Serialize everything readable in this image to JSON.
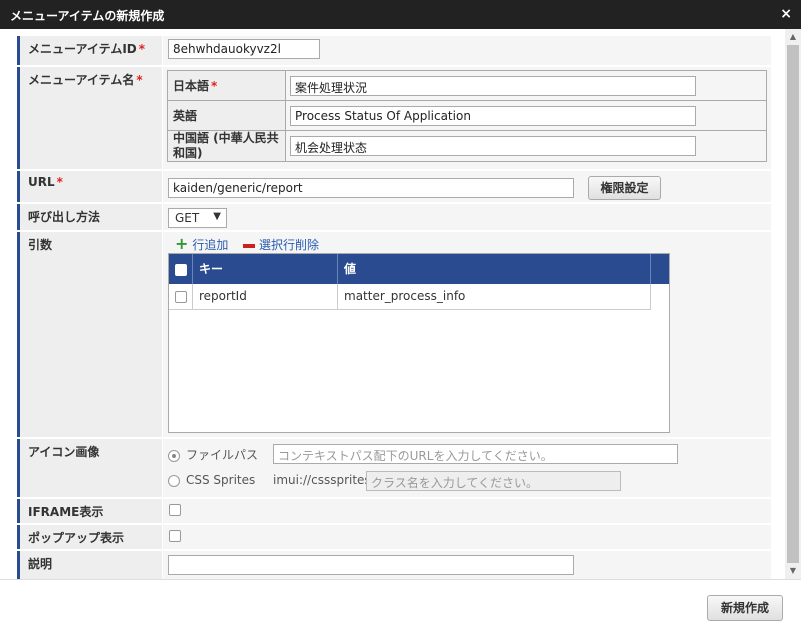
{
  "dialog": {
    "title": "メニューアイテムの新規作成",
    "close_label": "×"
  },
  "fields": {
    "id": {
      "label": "メニューアイテムID",
      "required_mark": "*",
      "value": "8ehwhdauokyvz2l"
    },
    "name": {
      "label": "メニューアイテム名",
      "required_mark": "*",
      "languages": [
        {
          "lang": "日本語",
          "required_mark": "*",
          "value": "案件処理状況"
        },
        {
          "lang": "英語",
          "value": "Process Status Of Application"
        },
        {
          "lang": "中国語 (中華人民共和国)",
          "value": "机会处理状态"
        }
      ]
    },
    "url": {
      "label": "URL",
      "required_mark": "*",
      "value": "kaiden/generic/report",
      "button_label": "権限設定"
    },
    "method": {
      "label": "呼び出し方法",
      "selected": "GET",
      "caret": "▼"
    },
    "params": {
      "label": "引数",
      "add_label": "行追加",
      "delete_label": "選択行削除",
      "columns": [
        "キー",
        "値"
      ],
      "rows": [
        {
          "key": "reportId",
          "value": "matter_process_info"
        }
      ]
    },
    "icon": {
      "label": "アイコン画像",
      "option_file": {
        "label": "ファイルパス",
        "checked": true,
        "placeholder": "コンテキストパス配下のURLを入力してください。"
      },
      "option_css": {
        "label": "CSS Sprites",
        "checked": false,
        "prefix": "imui://csssprites/",
        "placeholder": "クラス名を入力してください。"
      }
    },
    "iframe": {
      "label": "IFRAME表示",
      "checked": false
    },
    "popup": {
      "label": "ポップアップ表示",
      "checked": false
    },
    "description": {
      "label": "説明",
      "value": ""
    }
  },
  "footer": {
    "create_label": "新規作成"
  },
  "scrollbar": {
    "up": "▲",
    "down": "▼"
  },
  "colors": {
    "titlebar": "#222222",
    "accent": "#2a4b8f",
    "required": "#e02020",
    "link": "#2a5db0",
    "add_icon": "#2e9a2e",
    "delete_icon": "#cc2020"
  }
}
